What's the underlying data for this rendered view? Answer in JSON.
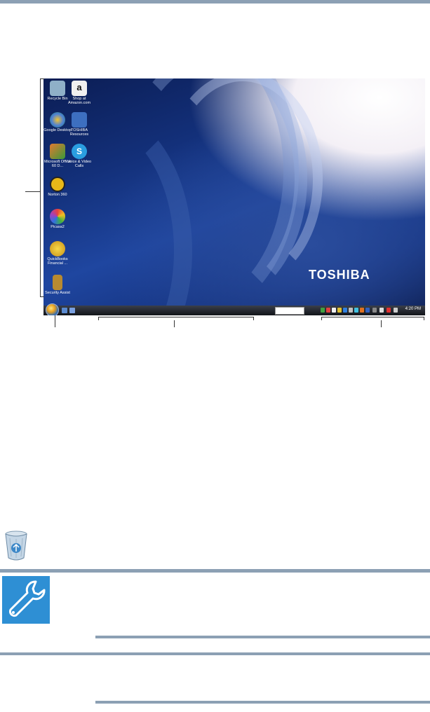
{
  "desktop": {
    "icons": [
      {
        "label": "Recycle Bin",
        "color": "#8fb0c8"
      },
      {
        "label": "Shop at Amazon.com",
        "color": "#f0f0f0"
      },
      {
        "label": "Google Desktop",
        "color": "#4a7fd8"
      },
      {
        "label": "TOSHIBA Resources",
        "color": "#3d6fc0"
      },
      {
        "label": "Microsoft Office 60 D...",
        "color": "#e07a30"
      },
      {
        "label": "Voice & Video Calls",
        "color": "#2a9ee0"
      },
      {
        "label": "Norton 360",
        "color": "#e8b818"
      },
      {
        "label": "Picasa2",
        "color": "#d85aa0"
      },
      {
        "label": "QuickBooks Financial ...",
        "color": "#e0b820"
      },
      {
        "label": "Security Assist",
        "color": "#b88a30"
      }
    ],
    "brand": "TOSHIBA",
    "taskbar": {
      "clock": "4:20 PM"
    }
  },
  "colors": {
    "rule": "#8ca0b4",
    "tools_icon_bg": "#2e8fd4"
  },
  "icons": {
    "recycle_bin": "recycle-bin-icon",
    "tools": "wrench-icon"
  }
}
